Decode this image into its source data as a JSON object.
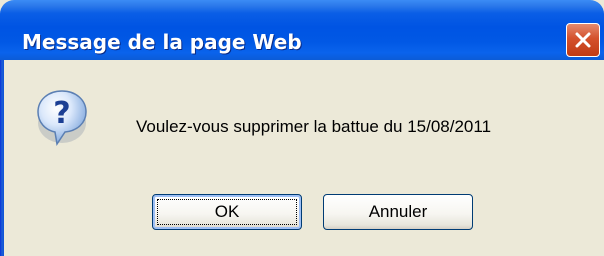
{
  "dialog": {
    "title": "Message de la page Web",
    "message": "Voulez-vous supprimer la battue du 15/08/2011",
    "icon": "question-icon",
    "close_icon": "close-icon"
  },
  "buttons": {
    "ok_label": "OK",
    "cancel_label": "Annuler"
  },
  "colors": {
    "titlebar": "#0054e3",
    "body": "#ece9d8",
    "close": "#d4512c"
  }
}
